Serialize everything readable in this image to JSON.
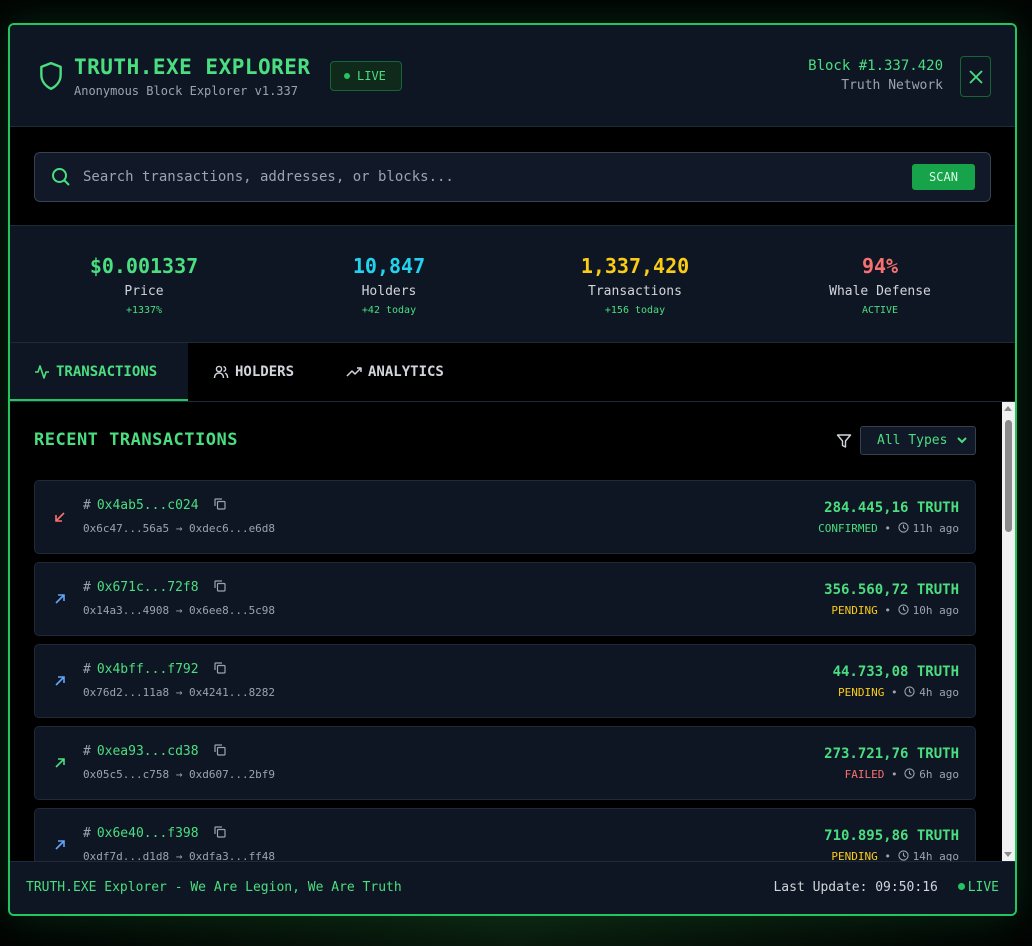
{
  "header": {
    "title": "TRUTH.EXE EXPLORER",
    "subtitle": "Anonymous Block Explorer v1.337",
    "live_label": "LIVE",
    "block_number": "Block #1.337.420",
    "network": "Truth Network",
    "icons": {
      "brand": "shield-icon",
      "close": "close-icon"
    }
  },
  "search": {
    "placeholder": "Search transactions, addresses, or blocks...",
    "value": "",
    "button_label": "SCAN"
  },
  "stats": [
    {
      "value": "$0.001337",
      "label": "Price",
      "change": "+1337%",
      "color": "#4ade80"
    },
    {
      "value": "10,847",
      "label": "Holders",
      "change": "+42 today",
      "color": "#22d3ee"
    },
    {
      "value": "1,337,420",
      "label": "Transactions",
      "change": "+156 today",
      "color": "#facc15"
    },
    {
      "value": "94%",
      "label": "Whale Defense",
      "change": "ACTIVE",
      "color": "#f87171"
    }
  ],
  "tabs": [
    {
      "label": "TRANSACTIONS",
      "icon": "activity-icon",
      "active": true
    },
    {
      "label": "HOLDERS",
      "icon": "users-icon",
      "active": false
    },
    {
      "label": "ANALYTICS",
      "icon": "trending-up-icon",
      "active": false
    }
  ],
  "transactions_panel": {
    "title": "RECENT TRANSACTIONS",
    "filter_selected": "All Types",
    "items": [
      {
        "hash": "0x4ab5...c024",
        "route": "0x6c47...56a5 → 0xdec6...e6d8",
        "amount": "284.445,16 TRUTH",
        "status": "CONFIRMED",
        "time": "11h ago",
        "direction": "in"
      },
      {
        "hash": "0x671c...72f8",
        "route": "0x14a3...4908 → 0x6ee8...5c98",
        "amount": "356.560,72 TRUTH",
        "status": "PENDING",
        "time": "10h ago",
        "direction": "out"
      },
      {
        "hash": "0x4bff...f792",
        "route": "0x76d2...11a8 → 0x4241...8282",
        "amount": "44.733,08 TRUTH",
        "status": "PENDING",
        "time": "4h ago",
        "direction": "out"
      },
      {
        "hash": "0xea93...cd38",
        "route": "0x05c5...c758 → 0xd607...2bf9",
        "amount": "273.721,76 TRUTH",
        "status": "FAILED",
        "time": "6h ago",
        "direction": "out-green"
      },
      {
        "hash": "0x6e40...f398",
        "route": "0xdf7d...d1d8 → 0xdfa3...ff48",
        "amount": "710.895,86 TRUTH",
        "status": "PENDING",
        "time": "14h ago",
        "direction": "out"
      }
    ]
  },
  "footer": {
    "tagline": "TRUTH.EXE Explorer - We Are Legion, We Are Truth",
    "last_update": "Last Update: 09:50:16",
    "live_label": "LIVE"
  }
}
